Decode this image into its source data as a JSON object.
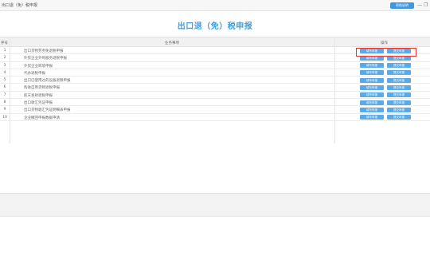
{
  "header": {
    "breadcrumb": "出口退（免）税申报",
    "help_label": "帮助说明",
    "minimize_glyph": "—",
    "maximize_glyph": "❐"
  },
  "page_title": "出口退（免）税申报",
  "table": {
    "columns": [
      "序号",
      "业务事项",
      "操作"
    ],
    "button_labels": {
      "fill": "填写申报",
      "submit": "提交申报"
    },
    "rows": [
      {
        "no": "1",
        "name": "出口货物劳务免退税申报"
      },
      {
        "no": "2",
        "name": "外贸企业外购服务退税申报"
      },
      {
        "no": "3",
        "name": "外贸企业跨境申报"
      },
      {
        "no": "4",
        "name": "代办退税申报"
      },
      {
        "no": "5",
        "name": "出口已使用过的设备退税申报"
      },
      {
        "no": "6",
        "name": "购进自用货物退税申报"
      },
      {
        "no": "7",
        "name": "航天发射退税申报"
      },
      {
        "no": "8",
        "name": "出口收汇凭证申报"
      },
      {
        "no": "9",
        "name": "出口货物收汇凭证明细表申报"
      },
      {
        "no": "10",
        "name": "企业撤回申报数据申请"
      }
    ]
  },
  "colors": {
    "accent": "#3a9fe3",
    "button": "#5aaae7",
    "highlight": "#e8322e"
  }
}
